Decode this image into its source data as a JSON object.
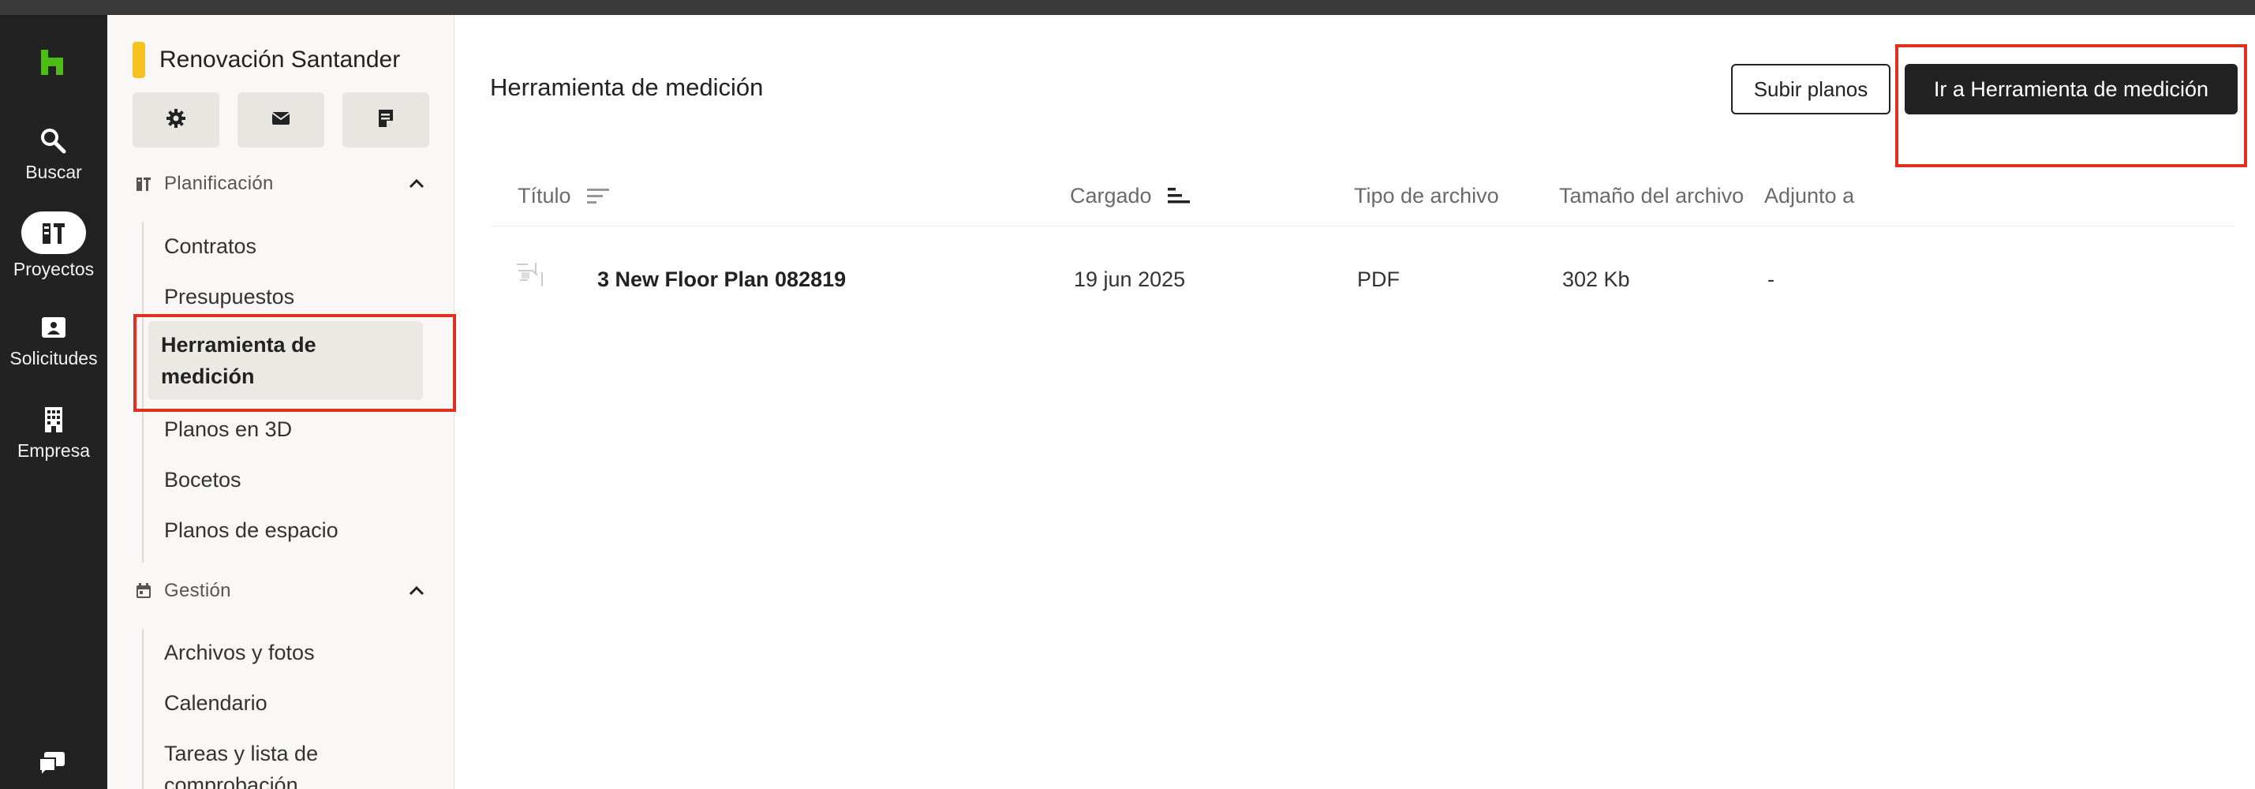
{
  "rail": {
    "items": [
      {
        "label": "Buscar",
        "icon": "search-icon"
      },
      {
        "label": "Proyectos",
        "icon": "projects-icon"
      },
      {
        "label": "Solicitudes",
        "icon": "requests-icon"
      },
      {
        "label": "Empresa",
        "icon": "building-icon"
      }
    ],
    "logo": "houzz-logo",
    "chat_icon": "chat-icon"
  },
  "sidebar": {
    "project_name": "Renovación Santander",
    "project_color": "#f7c120",
    "quick_actions": [
      {
        "icon": "gear-icon"
      },
      {
        "icon": "mail-icon"
      },
      {
        "icon": "note-icon"
      }
    ],
    "sections": [
      {
        "title": "Planificación",
        "icon": "planning-icon",
        "items": [
          "Contratos",
          "Presupuestos",
          "Herramienta de medición",
          "Planos en 3D",
          "Bocetos",
          "Planos de espacio"
        ]
      },
      {
        "title": "Gestión",
        "icon": "calendar-icon",
        "items": [
          "Archivos y fotos",
          "Calendario",
          "Tareas y lista de comprobación"
        ]
      }
    ],
    "active_item": "Herramienta de medición"
  },
  "main": {
    "title": "Herramienta de medición",
    "upload_button": "Subir planos",
    "go_button": "Ir a Herramienta de medición",
    "table": {
      "columns": [
        "Título",
        "Cargado",
        "Tipo de archivo",
        "Tamaño del archivo",
        "Adjunto a"
      ],
      "rows": [
        {
          "title": "3 New Floor Plan 082819",
          "uploaded": "19 jun 2025",
          "type": "PDF",
          "size": "302 Kb",
          "attached": "-"
        }
      ]
    }
  },
  "colors": {
    "accent_brand": "#4dbc15",
    "highlight": "#e0301e",
    "dark": "#222222"
  }
}
